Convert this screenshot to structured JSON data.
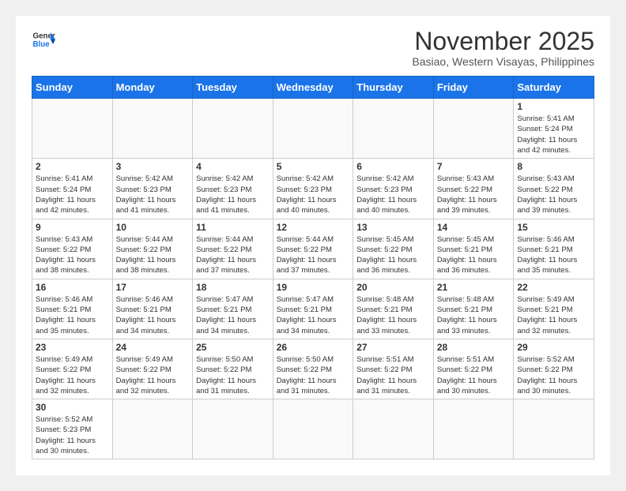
{
  "header": {
    "logo_general": "General",
    "logo_blue": "Blue",
    "month_title": "November 2025",
    "location": "Basiao, Western Visayas, Philippines"
  },
  "weekdays": [
    "Sunday",
    "Monday",
    "Tuesday",
    "Wednesday",
    "Thursday",
    "Friday",
    "Saturday"
  ],
  "weeks": [
    [
      {
        "day": "",
        "info": ""
      },
      {
        "day": "",
        "info": ""
      },
      {
        "day": "",
        "info": ""
      },
      {
        "day": "",
        "info": ""
      },
      {
        "day": "",
        "info": ""
      },
      {
        "day": "",
        "info": ""
      },
      {
        "day": "1",
        "info": "Sunrise: 5:41 AM\nSunset: 5:24 PM\nDaylight: 11 hours\nand 42 minutes."
      }
    ],
    [
      {
        "day": "2",
        "info": "Sunrise: 5:41 AM\nSunset: 5:24 PM\nDaylight: 11 hours\nand 42 minutes."
      },
      {
        "day": "3",
        "info": "Sunrise: 5:42 AM\nSunset: 5:23 PM\nDaylight: 11 hours\nand 41 minutes."
      },
      {
        "day": "4",
        "info": "Sunrise: 5:42 AM\nSunset: 5:23 PM\nDaylight: 11 hours\nand 41 minutes."
      },
      {
        "day": "5",
        "info": "Sunrise: 5:42 AM\nSunset: 5:23 PM\nDaylight: 11 hours\nand 40 minutes."
      },
      {
        "day": "6",
        "info": "Sunrise: 5:42 AM\nSunset: 5:23 PM\nDaylight: 11 hours\nand 40 minutes."
      },
      {
        "day": "7",
        "info": "Sunrise: 5:43 AM\nSunset: 5:22 PM\nDaylight: 11 hours\nand 39 minutes."
      },
      {
        "day": "8",
        "info": "Sunrise: 5:43 AM\nSunset: 5:22 PM\nDaylight: 11 hours\nand 39 minutes."
      }
    ],
    [
      {
        "day": "9",
        "info": "Sunrise: 5:43 AM\nSunset: 5:22 PM\nDaylight: 11 hours\nand 38 minutes."
      },
      {
        "day": "10",
        "info": "Sunrise: 5:44 AM\nSunset: 5:22 PM\nDaylight: 11 hours\nand 38 minutes."
      },
      {
        "day": "11",
        "info": "Sunrise: 5:44 AM\nSunset: 5:22 PM\nDaylight: 11 hours\nand 37 minutes."
      },
      {
        "day": "12",
        "info": "Sunrise: 5:44 AM\nSunset: 5:22 PM\nDaylight: 11 hours\nand 37 minutes."
      },
      {
        "day": "13",
        "info": "Sunrise: 5:45 AM\nSunset: 5:22 PM\nDaylight: 11 hours\nand 36 minutes."
      },
      {
        "day": "14",
        "info": "Sunrise: 5:45 AM\nSunset: 5:21 PM\nDaylight: 11 hours\nand 36 minutes."
      },
      {
        "day": "15",
        "info": "Sunrise: 5:46 AM\nSunset: 5:21 PM\nDaylight: 11 hours\nand 35 minutes."
      }
    ],
    [
      {
        "day": "16",
        "info": "Sunrise: 5:46 AM\nSunset: 5:21 PM\nDaylight: 11 hours\nand 35 minutes."
      },
      {
        "day": "17",
        "info": "Sunrise: 5:46 AM\nSunset: 5:21 PM\nDaylight: 11 hours\nand 34 minutes."
      },
      {
        "day": "18",
        "info": "Sunrise: 5:47 AM\nSunset: 5:21 PM\nDaylight: 11 hours\nand 34 minutes."
      },
      {
        "day": "19",
        "info": "Sunrise: 5:47 AM\nSunset: 5:21 PM\nDaylight: 11 hours\nand 34 minutes."
      },
      {
        "day": "20",
        "info": "Sunrise: 5:48 AM\nSunset: 5:21 PM\nDaylight: 11 hours\nand 33 minutes."
      },
      {
        "day": "21",
        "info": "Sunrise: 5:48 AM\nSunset: 5:21 PM\nDaylight: 11 hours\nand 33 minutes."
      },
      {
        "day": "22",
        "info": "Sunrise: 5:49 AM\nSunset: 5:21 PM\nDaylight: 11 hours\nand 32 minutes."
      }
    ],
    [
      {
        "day": "23",
        "info": "Sunrise: 5:49 AM\nSunset: 5:22 PM\nDaylight: 11 hours\nand 32 minutes."
      },
      {
        "day": "24",
        "info": "Sunrise: 5:49 AM\nSunset: 5:22 PM\nDaylight: 11 hours\nand 32 minutes."
      },
      {
        "day": "25",
        "info": "Sunrise: 5:50 AM\nSunset: 5:22 PM\nDaylight: 11 hours\nand 31 minutes."
      },
      {
        "day": "26",
        "info": "Sunrise: 5:50 AM\nSunset: 5:22 PM\nDaylight: 11 hours\nand 31 minutes."
      },
      {
        "day": "27",
        "info": "Sunrise: 5:51 AM\nSunset: 5:22 PM\nDaylight: 11 hours\nand 31 minutes."
      },
      {
        "day": "28",
        "info": "Sunrise: 5:51 AM\nSunset: 5:22 PM\nDaylight: 11 hours\nand 30 minutes."
      },
      {
        "day": "29",
        "info": "Sunrise: 5:52 AM\nSunset: 5:22 PM\nDaylight: 11 hours\nand 30 minutes."
      }
    ],
    [
      {
        "day": "30",
        "info": "Sunrise: 5:52 AM\nSunset: 5:23 PM\nDaylight: 11 hours\nand 30 minutes."
      },
      {
        "day": "",
        "info": ""
      },
      {
        "day": "",
        "info": ""
      },
      {
        "day": "",
        "info": ""
      },
      {
        "day": "",
        "info": ""
      },
      {
        "day": "",
        "info": ""
      },
      {
        "day": "",
        "info": ""
      }
    ]
  ]
}
